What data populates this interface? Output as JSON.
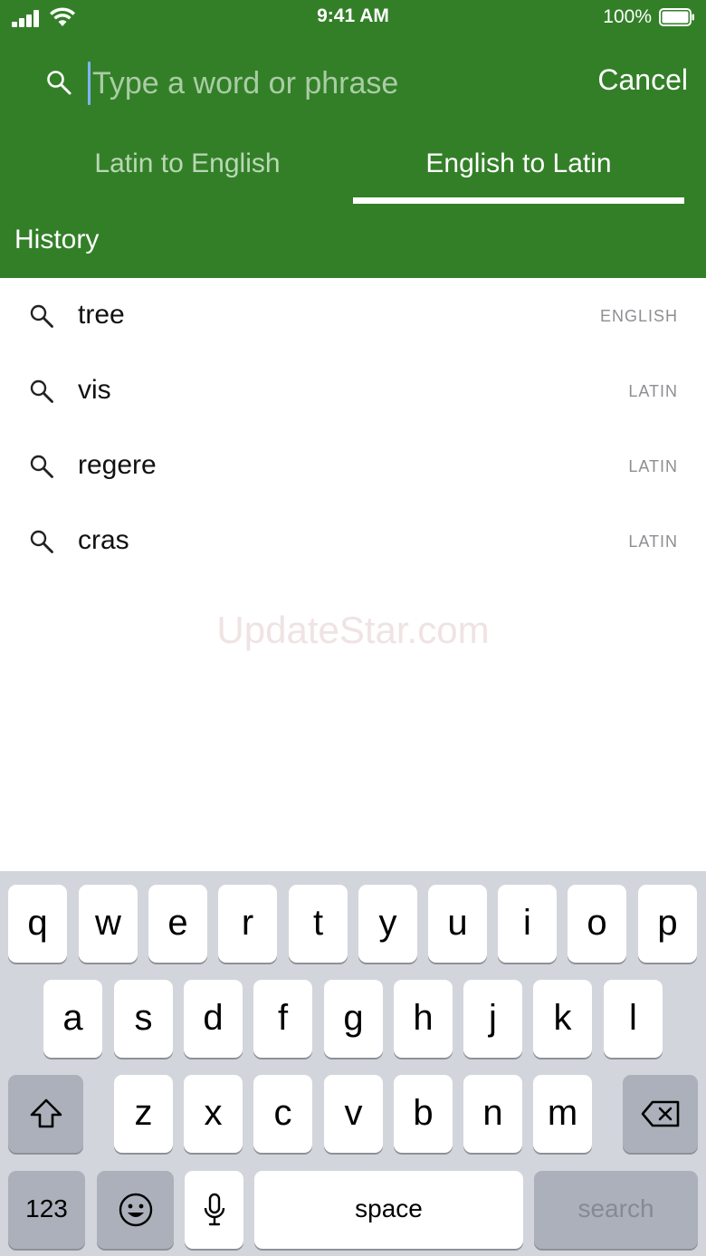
{
  "status": {
    "time": "9:41 AM",
    "battery": "100%"
  },
  "search": {
    "placeholder": "Type a word or phrase",
    "cancel_label": "Cancel"
  },
  "tabs": [
    {
      "label": "Latin to English",
      "active": false
    },
    {
      "label": "English to Latin",
      "active": true
    }
  ],
  "history": {
    "title": "History",
    "items": [
      {
        "word": "tree",
        "lang": "ENGLISH"
      },
      {
        "word": "vis",
        "lang": "LATIN"
      },
      {
        "word": "regere",
        "lang": "LATIN"
      },
      {
        "word": "cras",
        "lang": "LATIN"
      }
    ]
  },
  "watermark": "UpdateStar.com",
  "keyboard": {
    "row1": [
      "q",
      "w",
      "e",
      "r",
      "t",
      "y",
      "u",
      "i",
      "o",
      "p"
    ],
    "row2": [
      "a",
      "s",
      "d",
      "f",
      "g",
      "h",
      "j",
      "k",
      "l"
    ],
    "row3": [
      "z",
      "x",
      "c",
      "v",
      "b",
      "n",
      "m"
    ],
    "numbers_label": "123",
    "space_label": "space",
    "search_label": "search"
  },
  "colors": {
    "header": "#337f28",
    "keyboard_bg": "#d2d5db"
  },
  "icons": [
    "search-icon",
    "shift-icon",
    "backspace-icon",
    "emoji-icon",
    "microphone-icon"
  ]
}
